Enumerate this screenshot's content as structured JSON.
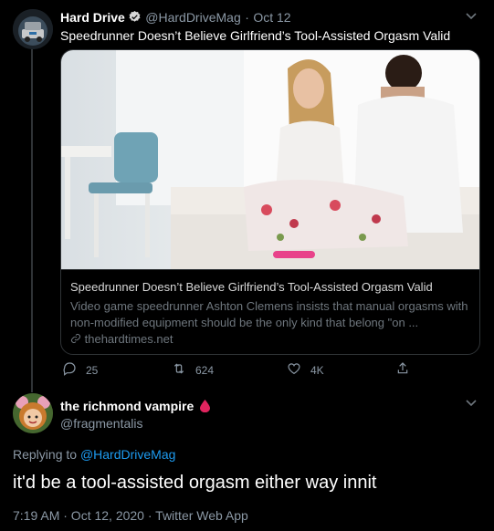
{
  "tweet": {
    "author_name": "Hard Drive",
    "author_handle": "@HardDriveMag",
    "date": "Oct 12",
    "text": "Speedrunner Doesn’t Believe Girlfriend’s Tool-Assisted Orgasm Valid",
    "card": {
      "title": "Speedrunner Doesn’t Believe Girlfriend’s Tool-Assisted Orgasm Valid",
      "description": "Video game speedrunner Ashton Clemens insists that manual orgasms with non-modified equipment should be the only kind that belong \"on ...",
      "domain": "thehardtimes.net"
    },
    "actions": {
      "replies": "25",
      "retweets": "624",
      "likes": "4K"
    }
  },
  "reply": {
    "author_name": "the richmond vampire",
    "author_handle": "@fragmentalis",
    "replying_prefix": "Replying to",
    "replying_to": "@HardDriveMag",
    "text": "it'd be a tool-assisted orgasm either way innit",
    "timestamp": "7:19 AM · Oct 12, 2020 · Twitter Web App"
  },
  "colors": {
    "background": "#000000",
    "accent": "#1d9bf0",
    "muted": "#8b98a5",
    "blood_drop": "#e0245e"
  },
  "icons": [
    "verified-badge-icon",
    "chevron-down-icon",
    "link-icon",
    "reply-icon",
    "retweet-icon",
    "like-icon",
    "share-icon",
    "blood-drop-icon"
  ]
}
